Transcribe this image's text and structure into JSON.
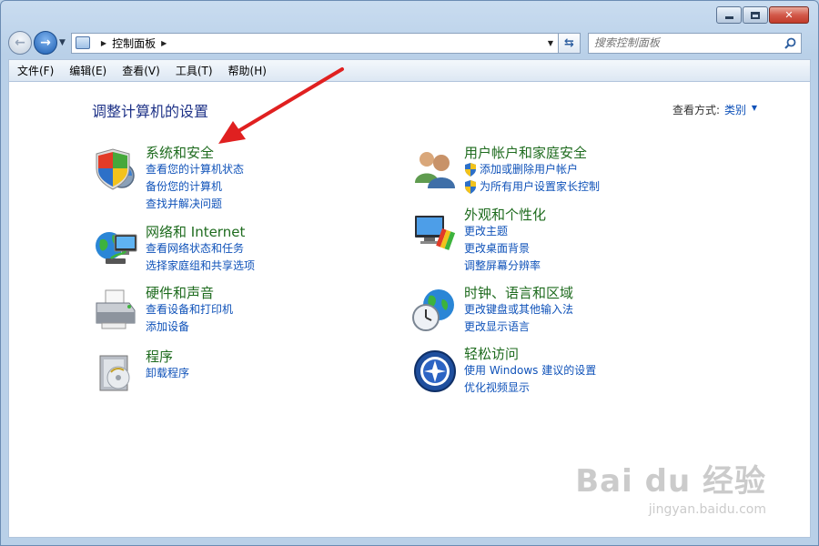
{
  "window": {
    "caption_buttons": [
      "minimize",
      "maximize",
      "close"
    ]
  },
  "address_bar": {
    "breadcrumb": "控制面板"
  },
  "search": {
    "placeholder": "搜索控制面板"
  },
  "menu": {
    "items": [
      "文件(F)",
      "编辑(E)",
      "查看(V)",
      "工具(T)",
      "帮助(H)"
    ]
  },
  "content": {
    "title": "调整计算机的设置",
    "view_by_label": "查看方式:",
    "view_by_value": "类别"
  },
  "categories": [
    {
      "title": "系统和安全",
      "icon": "shield-pc-icon",
      "links": [
        "查看您的计算机状态",
        "备份您的计算机",
        "查找并解决问题"
      ]
    },
    {
      "title": "网络和 Internet",
      "icon": "network-globe-icon",
      "links": [
        "查看网络状态和任务",
        "选择家庭组和共享选项"
      ]
    },
    {
      "title": "硬件和声音",
      "icon": "printer-icon",
      "links": [
        "查看设备和打印机",
        "添加设备"
      ]
    },
    {
      "title": "程序",
      "icon": "programs-icon",
      "links": [
        "卸载程序"
      ]
    },
    {
      "title": "用户帐户和家庭安全",
      "icon": "users-icon",
      "links": [
        "添加或删除用户帐户",
        "为所有用户设置家长控制"
      ]
    },
    {
      "title": "外观和个性化",
      "icon": "monitor-palette-icon",
      "links": [
        "更改主题",
        "更改桌面背景",
        "调整屏幕分辨率"
      ]
    },
    {
      "title": "时钟、语言和区域",
      "icon": "clock-globe-icon",
      "links": [
        "更改键盘或其他输入法",
        "更改显示语言"
      ]
    },
    {
      "title": "轻松访问",
      "icon": "ease-of-access-icon",
      "links": [
        "使用 Windows 建议的设置",
        "优化视频显示"
      ]
    }
  ],
  "watermark": {
    "brand": "Bai du 经验",
    "url": "jingyan.baidu.com"
  },
  "colors": {
    "category_title": "#1e6b1e",
    "link": "#0f52b9",
    "page_title": "#1e3287",
    "annotation_arrow": "#e02020"
  }
}
